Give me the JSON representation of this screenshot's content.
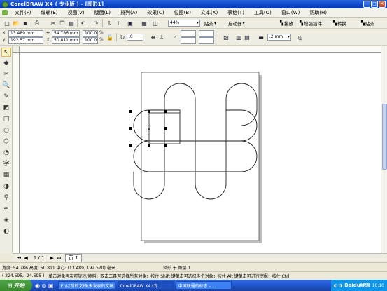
{
  "window": {
    "title": "CorelDRAW X4 ( 专业版 ) - [图形1]",
    "controls": [
      "_",
      "□",
      "×"
    ]
  },
  "menu": [
    "文件(F)",
    "编辑(E)",
    "视图(V)",
    "版面(L)",
    "排列(A)",
    "效果(C)",
    "位图(B)",
    "文本(X)",
    "表格(T)",
    "工具(O)",
    "窗口(W)",
    "帮助(H)"
  ],
  "standard_toolbar": {
    "zoom": "44%",
    "snap_label": "贴齐",
    "launcher_label": "启动器",
    "right_items": [
      "排放",
      "增强插件",
      "转换",
      "贴齐"
    ]
  },
  "property_bar": {
    "x": "13.489 mm",
    "y": "192.57 mm",
    "width": "54.786 mm",
    "height": "50.811 mm",
    "scale_x": "100.0",
    "scale_y": "100.0",
    "percent": "%",
    "rotation": ".0",
    "outline_width": ".2 mm"
  },
  "page_tabs": {
    "counter": "1 / 1",
    "tab": "页 1"
  },
  "status": {
    "size": "宽度: 54.786  高度: 50.811  中心: (13.489, 192.570)  毫米",
    "object": "矩形 于 图层 1",
    "coords": "( 224.595, -24.695 )",
    "hint": "单击对象再次可旋转/倾斜；双击工具可选择所有对象；按住 Shift 键单击可选择多个对象；按住 Alt 键单击可进行挖掘；按住 Ctrl"
  },
  "taskbar": {
    "start": "开始",
    "tasks": [
      "E:\\以前的文档\\未发表的文稿",
      "CorelDRAW X4 (专...",
      "中国联通的标志 - ..."
    ],
    "clock": "10:10",
    "watermark": "Baidu经验"
  }
}
